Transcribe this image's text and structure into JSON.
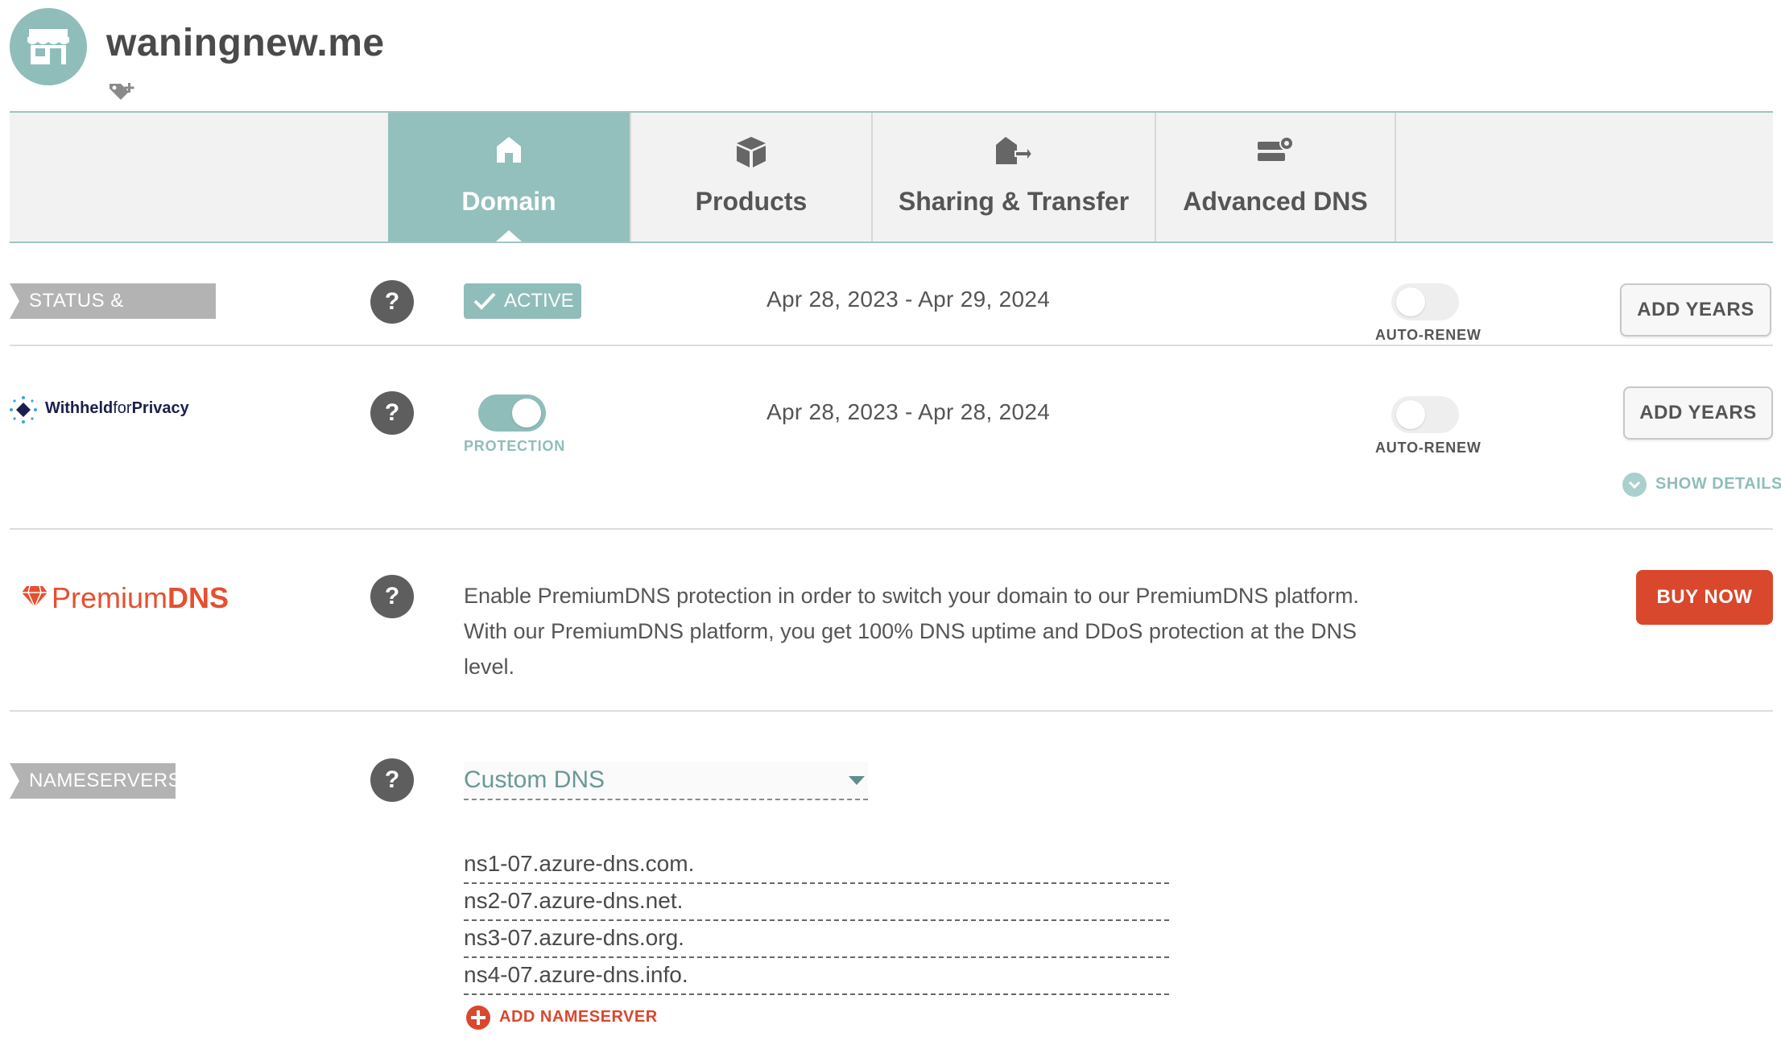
{
  "header": {
    "domain": "waningnew.me",
    "avatar_icon": "store-icon",
    "tag_icon": "add-tag-icon"
  },
  "tabs": [
    {
      "label": "Domain",
      "icon": "home-icon",
      "active": true
    },
    {
      "label": "Products",
      "icon": "box-icon",
      "active": false
    },
    {
      "label": "Sharing & Transfer",
      "icon": "transfer-icon",
      "active": false
    },
    {
      "label": "Advanced DNS",
      "icon": "server-gear-icon",
      "active": false
    }
  ],
  "status": {
    "label": "STATUS & VALIDITY",
    "help": "?",
    "badge": "ACTIVE",
    "dates": "Apr 28, 2023 - Apr 29, 2024",
    "auto_renew_label": "AUTO-RENEW",
    "auto_renew_on": false,
    "add_years": "ADD YEARS"
  },
  "privacy": {
    "brand_strong": "Withheld",
    "brand_light": "for",
    "brand_end": "Privacy",
    "help": "?",
    "protection_label": "PROTECTION",
    "protection_on": true,
    "dates": "Apr 28, 2023 - Apr 28, 2024",
    "auto_renew_label": "AUTO-RENEW",
    "auto_renew_on": false,
    "add_years": "ADD YEARS",
    "show_details": "SHOW DETAILS"
  },
  "premium": {
    "brand_light": "Premium",
    "brand_bold": "DNS",
    "help": "?",
    "description": "Enable PremiumDNS protection in order to switch your domain to our PremiumDNS platform.",
    "description_2": "With our PremiumDNS platform, you get 100% DNS uptime and DDoS protection at the DNS",
    "description_3": "level.",
    "buy_now": "BUY NOW"
  },
  "nameservers": {
    "label": "NAMESERVERS",
    "help": "?",
    "type": "Custom DNS",
    "entries": [
      "ns1-07.azure-dns.com.",
      "ns2-07.azure-dns.net.",
      "ns3-07.azure-dns.org.",
      "ns4-07.azure-dns.info."
    ],
    "add_label": "ADD NAMESERVER"
  },
  "colors": {
    "accent": "#8fbdba",
    "danger": "#d9472d",
    "ribbon": "#b3b3b3"
  }
}
